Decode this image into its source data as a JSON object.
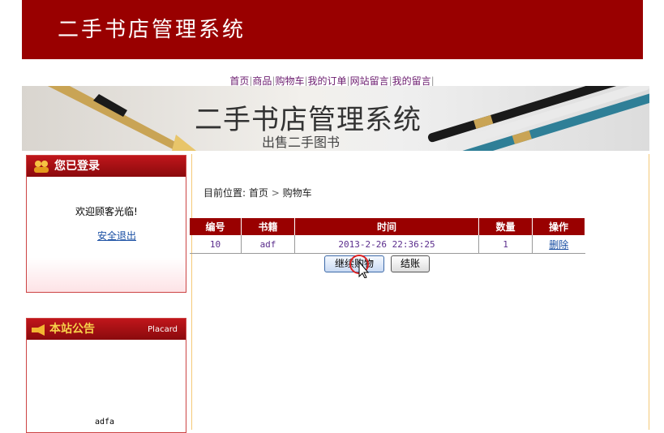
{
  "header": {
    "title": "二手书店管理系统"
  },
  "nav": {
    "items": [
      "首页",
      "商品",
      "购物车",
      "我的订单",
      "网站留言",
      "我的留言"
    ]
  },
  "banner": {
    "title": "二手书店管理系统",
    "subtitle": "出售二手图书"
  },
  "login_panel": {
    "title": "您已登录",
    "welcome": "欢迎顾客光临!",
    "logout": "安全退出"
  },
  "notice_panel": {
    "title": "本站公告",
    "tag": "Placard",
    "content": "adfa"
  },
  "breadcrumb": {
    "prefix": "目前位置:",
    "home": "首页",
    "sep": ">",
    "current": "购物车"
  },
  "cart": {
    "headers": [
      "编号",
      "书籍",
      "时间",
      "数量",
      "操作"
    ],
    "rows": [
      {
        "id": "10",
        "book": "adf",
        "time": "2013-2-26 22:36:25",
        "qty": "1",
        "action": "删除"
      }
    ]
  },
  "buttons": {
    "continue": "继续购物",
    "checkout": "结账"
  },
  "colors": {
    "brand": "#990000",
    "link": "#6b1b6e",
    "cell_text": "#5a2c8c"
  }
}
